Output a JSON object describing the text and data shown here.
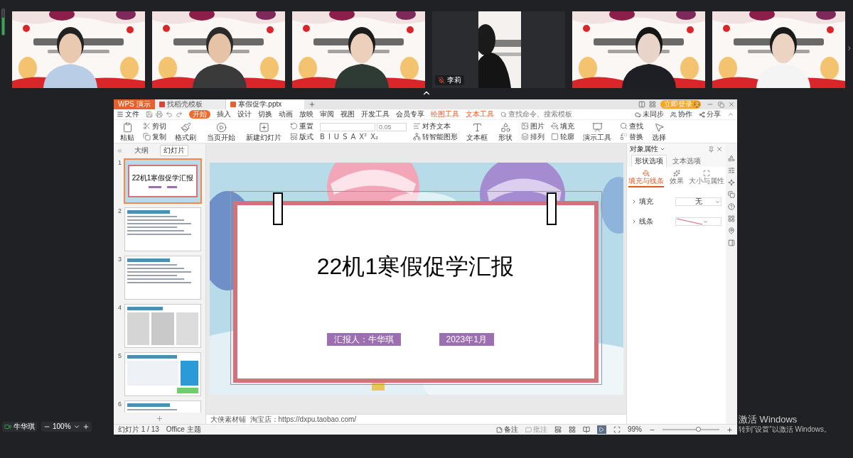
{
  "video_tiles": [
    {
      "kind": "video"
    },
    {
      "kind": "video"
    },
    {
      "kind": "video"
    },
    {
      "kind": "partial",
      "name": "李莉",
      "muted": true
    },
    {
      "kind": "video"
    },
    {
      "kind": "video"
    }
  ],
  "self_view": {
    "name": "牛华琪",
    "zoom": "100%"
  },
  "wps": {
    "tabs": [
      {
        "label": "WPS 演示",
        "kind": "app",
        "selected": false
      },
      {
        "label": "找稻壳模板",
        "kind": "doc",
        "selected": false
      },
      {
        "label": "寒假促学.pptx",
        "kind": "doc",
        "selected": true
      }
    ],
    "login_button": "立即登录",
    "menu": [
      {
        "label": "文件",
        "kind": "file",
        "selected": false
      },
      {
        "label": "开始",
        "kind": "tab",
        "selected": true
      },
      {
        "label": "插入",
        "kind": "tab",
        "selected": false
      },
      {
        "label": "设计",
        "kind": "tab",
        "selected": false
      },
      {
        "label": "切换",
        "kind": "tab",
        "selected": false
      },
      {
        "label": "动画",
        "kind": "tab",
        "selected": false
      },
      {
        "label": "放映",
        "kind": "tab",
        "selected": false
      },
      {
        "label": "审阅",
        "kind": "tab",
        "selected": false
      },
      {
        "label": "视图",
        "kind": "tab",
        "selected": false
      },
      {
        "label": "开发工具",
        "kind": "tab",
        "selected": false
      },
      {
        "label": "会员专享",
        "kind": "tab",
        "selected": false
      },
      {
        "label": "绘图工具",
        "kind": "contextual",
        "selected": false
      },
      {
        "label": "文本工具",
        "kind": "contextual",
        "selected": false
      }
    ],
    "search_placeholder": "查找命令、搜索模板",
    "share_actions": [
      "未同步",
      "协作",
      "分享"
    ],
    "toolbar": [
      {
        "kind": "large",
        "label": "粘贴"
      },
      {
        "kind": "pair",
        "labels": [
          "剪切",
          "复制"
        ]
      },
      {
        "kind": "large",
        "label": "格式刷"
      },
      {
        "kind": "large",
        "label": "当页开始"
      },
      {
        "kind": "large",
        "label": "新建幻灯片"
      },
      {
        "kind": "pair",
        "labels": [
          "重置",
          "版式"
        ]
      },
      {
        "kind": "font",
        "size": "0.05",
        "buttons": [
          "B",
          "I",
          "U",
          "S",
          "A",
          "X²",
          "X₂"
        ]
      },
      {
        "kind": "pair",
        "labels": [
          "对齐文本",
          "转智能图形"
        ]
      },
      {
        "kind": "large",
        "label": "文本框"
      },
      {
        "kind": "large",
        "label": "形状"
      },
      {
        "kind": "pair",
        "labels": [
          "图片",
          "排列"
        ]
      },
      {
        "kind": "pair",
        "labels": [
          "填充",
          "轮廓"
        ]
      },
      {
        "kind": "large",
        "label": "演示工具"
      },
      {
        "kind": "pair",
        "labels": [
          "查找",
          "替换"
        ]
      },
      {
        "kind": "large",
        "label": "选择"
      }
    ],
    "panel_tabs": [
      {
        "label": "大纲",
        "selected": false
      },
      {
        "label": "幻灯片",
        "selected": true
      }
    ],
    "slides": [
      {
        "number": "1",
        "kind": "title",
        "selected": true,
        "title": "22机1寒假促学汇报"
      },
      {
        "number": "2",
        "kind": "text",
        "selected": false
      },
      {
        "number": "3",
        "kind": "text",
        "selected": false
      },
      {
        "number": "4",
        "kind": "photos",
        "selected": false
      },
      {
        "number": "5",
        "kind": "chat",
        "selected": false
      },
      {
        "number": "6",
        "kind": "text",
        "selected": false
      }
    ],
    "slide": {
      "title": "22机1寒假促学汇报",
      "presenter": "汇报人：牛华琪",
      "date": "2023年1月"
    },
    "notes": "大侠素材铺  淘宝店：https://dxpu.taobao.com/",
    "properties": {
      "title": "对象属性",
      "tabs": [
        {
          "label": "形状选项",
          "selected": true
        },
        {
          "label": "文本选项",
          "selected": false
        }
      ],
      "subtabs": [
        {
          "label": "填充与线条",
          "selected": true
        },
        {
          "label": "效果",
          "selected": false
        },
        {
          "label": "大小与属性",
          "selected": false
        }
      ],
      "rows": [
        {
          "label": "填充",
          "kind": "text",
          "value": "无"
        },
        {
          "label": "线条",
          "kind": "line"
        }
      ]
    },
    "status": {
      "slide_counter": "幻灯片 1 / 13",
      "theme": "Office 主题",
      "notes": "备注",
      "comments": "批注",
      "zoom": "99%",
      "zoom_slider": {
        "level": 0.62
      }
    }
  },
  "os_notice": {
    "title": "激活 Windows",
    "text": "转到“设置”以激活 Windows。"
  }
}
